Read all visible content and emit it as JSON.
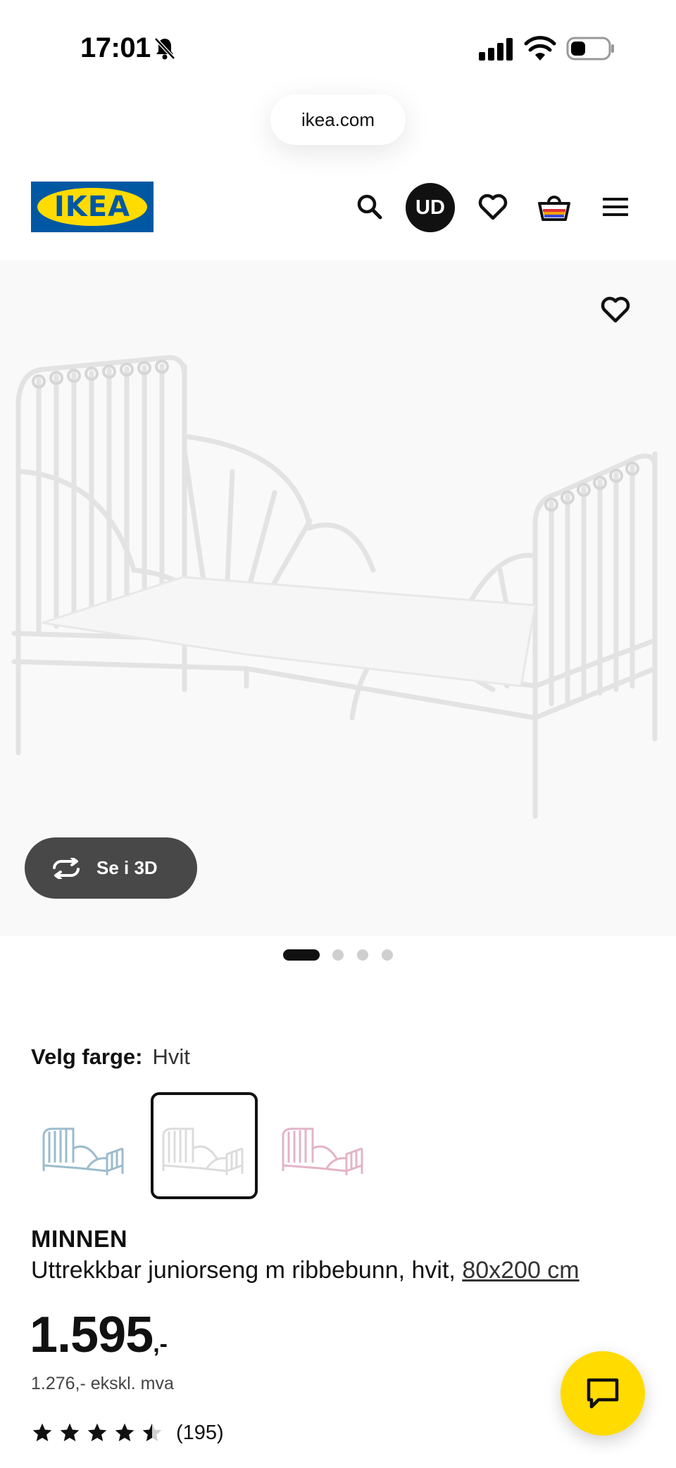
{
  "status_bar": {
    "time": "17:01",
    "icons": [
      "bell-muted-icon",
      "cellular-signal-icon",
      "wifi-icon",
      "battery-icon"
    ]
  },
  "browser": {
    "url": "ikea.com"
  },
  "header": {
    "logo_text": "IKEA",
    "avatar_initials": "UD",
    "icons": [
      "search-icon",
      "heart-icon",
      "cart-icon",
      "menu-icon"
    ]
  },
  "gallery": {
    "view_3d_label": "Se i 3D",
    "page_count": 4,
    "active_page": 1
  },
  "color_chooser": {
    "label": "Velg farge:",
    "selected_value": "Hvit",
    "swatches": [
      {
        "name": "blue",
        "color": "#9bbccc",
        "selected": false
      },
      {
        "name": "white",
        "color": "#ececec",
        "selected": true
      },
      {
        "name": "pink",
        "color": "#e3b4c6",
        "selected": false
      }
    ]
  },
  "product": {
    "name": "MINNEN",
    "description": "Uttrekkbar juniorseng m ribbebunn, hvit,",
    "size_link": "80x200 cm",
    "price_main": "1.595",
    "price_suffix": ",-",
    "price_ex_vat": "1.276,- ekskl. mva",
    "rating": 4.5,
    "review_count": "(195)"
  },
  "colors": {
    "ikea_blue": "#0058a3",
    "ikea_yellow": "#ffdb00",
    "button_dark": "#484848"
  }
}
